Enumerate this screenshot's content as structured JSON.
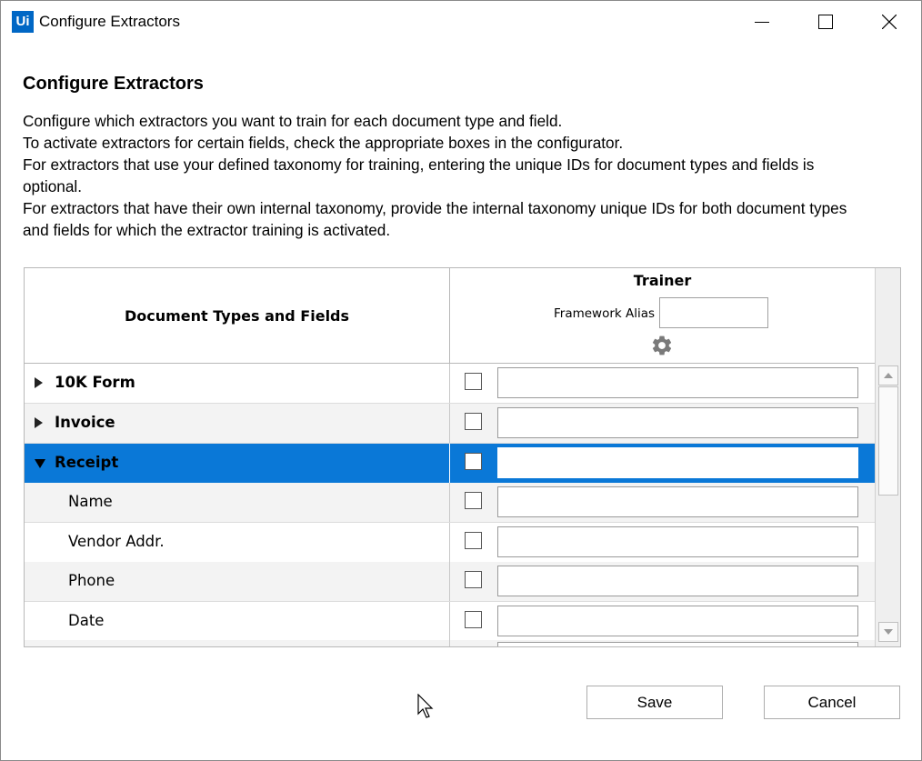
{
  "window": {
    "app_icon_text": "Ui",
    "title": "Configure Extractors"
  },
  "page": {
    "heading": "Configure Extractors",
    "description": [
      "Configure which extractors you want to train for each document type and field.",
      "To activate extractors for certain fields, check the appropriate boxes in the configurator.",
      "For extractors that use your defined taxonomy for training, entering the unique IDs for document types and fields is",
      "optional.",
      "For extractors that have their own internal taxonomy, provide the internal taxonomy unique IDs for both document types",
      "and fields for which the extractor training is activated."
    ]
  },
  "grid": {
    "column_header": "Document Types and Fields",
    "extractor_name": "Trainer",
    "framework_alias_label": "Framework Alias",
    "framework_alias_value": "",
    "settings_icon": "gear-icon",
    "rows": [
      {
        "label": "10K Form",
        "kind": "type",
        "expanded": false,
        "selected": false,
        "checked": false,
        "id_value": ""
      },
      {
        "label": "Invoice",
        "kind": "type",
        "expanded": false,
        "selected": false,
        "checked": false,
        "id_value": ""
      },
      {
        "label": "Receipt",
        "kind": "type",
        "expanded": true,
        "selected": true,
        "checked": false,
        "id_value": ""
      },
      {
        "label": "Name",
        "kind": "field",
        "selected": false,
        "checked": false,
        "id_value": ""
      },
      {
        "label": "Vendor Addr.",
        "kind": "field",
        "selected": false,
        "checked": false,
        "id_value": ""
      },
      {
        "label": "Phone",
        "kind": "field",
        "selected": false,
        "checked": false,
        "id_value": ""
      },
      {
        "label": "Date",
        "kind": "field",
        "selected": false,
        "checked": false,
        "id_value": ""
      }
    ]
  },
  "buttons": {
    "save": "Save",
    "cancel": "Cancel"
  },
  "colors": {
    "selection": "#0a78d7",
    "app_icon": "#0067c5"
  }
}
